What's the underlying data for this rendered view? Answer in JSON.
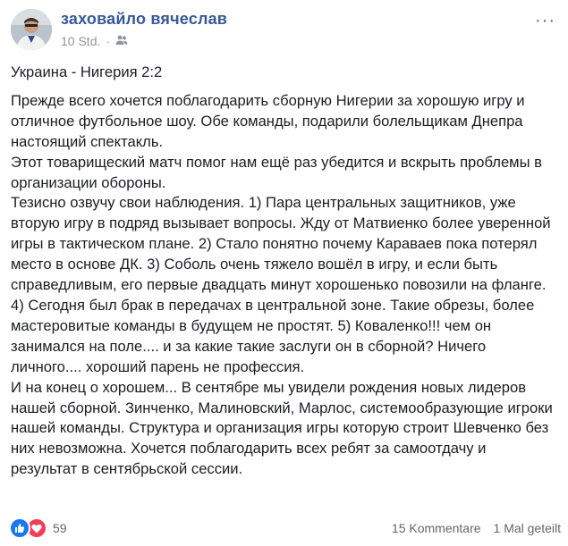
{
  "post": {
    "author": "заховайло вячеслав",
    "time": "10 Std.",
    "separator": "·",
    "audience_icon": "friends-icon",
    "more_label": "···",
    "title": "Украина - Нигерия 2:2",
    "paragraphs": [
      "Прежде всего хочется поблагодарить сборную Нигерии за хорошую игру и отличное футбольное шоу. Обе команды, подарили болельщикам Днепра настоящий спектакль.\nЭтот товарищеский матч помог нам ещё раз убедится и вскрыть проблемы в организации обороны.\nТезисно озвучу свои наблюдения. 1) Пара центральных защитников, уже вторую игру в подряд вызывает вопросы. Жду от Матвиенко более уверенной игры в тактическом плане. 2) Стало понятно почему Караваев пока потерял место в основе ДК. 3) Соболь очень тяжело вошёл в игру, и если быть справедливым, его первые двадцать минут хорошенько повозили на фланге. 4) Сегодня был брак в передачах в центральной зоне. Такие обрезы, более мастеровитые команды в будущем не простят. 5) Коваленко!!! чем он занимался на поле.... и за какие такие заслуги он в сборной? Ничего личного.... хороший парень не профессия.\nИ на конец о хорошем... В сентябре мы увидели рождения новых лидеров нашей сборной. Зинченко, Малиновский, Марлос, системообразующие игроки нашей команды. Структура и организация игры которую строит Шевченко без них невозможна. Хочется поблагодарить всех ребят за самоотдачу и результат в сентябрьской сессии."
    ]
  },
  "footer": {
    "reaction_count": "59",
    "comments": "15 Kommentare",
    "shares": "1 Mal geteilt"
  },
  "colors": {
    "author": "#385898",
    "meta": "#90949c",
    "like": "#1877f2",
    "love": "#f33e58"
  }
}
